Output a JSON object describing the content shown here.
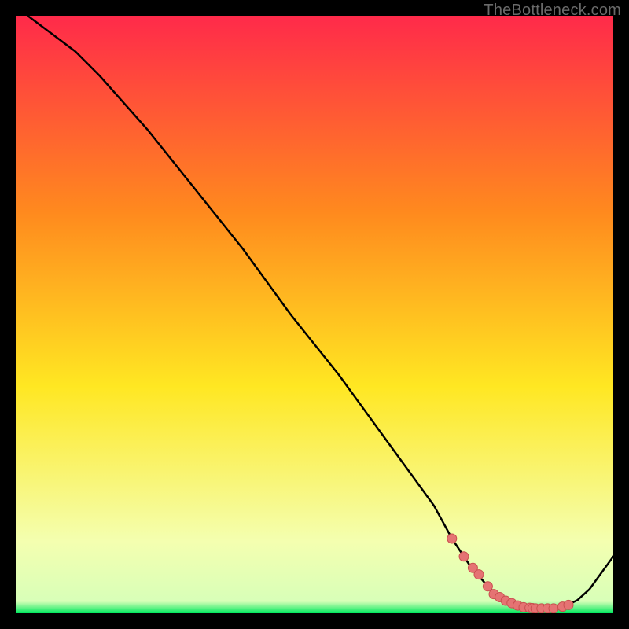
{
  "watermark": "TheBottleneck.com",
  "colors": {
    "bg": "#000000",
    "grad_top": "#ff2a4a",
    "grad_mid1": "#ff8a1e",
    "grad_mid2": "#ffe722",
    "grad_btm_light": "#f4ffb0",
    "grad_green": "#00e85e",
    "curve": "#000000",
    "dot_fill": "#e57373",
    "dot_stroke": "#c94f4f"
  },
  "chart_data": {
    "type": "line",
    "title": "",
    "xlabel": "",
    "ylabel": "",
    "xlim": [
      0,
      100
    ],
    "ylim": [
      0,
      100
    ],
    "x": [
      2,
      6,
      10,
      14,
      18,
      22,
      26,
      30,
      34,
      38,
      42,
      46,
      50,
      54,
      58,
      62,
      66,
      70,
      73,
      76,
      79,
      81,
      83,
      85,
      87,
      90,
      92,
      94,
      96,
      100
    ],
    "y": [
      100,
      97,
      94,
      90,
      85.5,
      81,
      76,
      71,
      66,
      61,
      55.5,
      50,
      45,
      40,
      34.5,
      29,
      23.5,
      18,
      12.5,
      8,
      4.5,
      2.7,
      1.7,
      1.0,
      0.8,
      0.8,
      1.2,
      2.2,
      4.0,
      9.5
    ],
    "dots": {
      "x": [
        73,
        75,
        76.5,
        77.5,
        79,
        80,
        81,
        82,
        83,
        84,
        85,
        86,
        86.5,
        87,
        88,
        89,
        90,
        91.5,
        92.5
      ],
      "y": [
        12.5,
        9.5,
        7.6,
        6.5,
        4.5,
        3.2,
        2.7,
        2.1,
        1.7,
        1.3,
        1.0,
        0.9,
        0.85,
        0.8,
        0.8,
        0.8,
        0.8,
        1.1,
        1.4
      ]
    }
  }
}
